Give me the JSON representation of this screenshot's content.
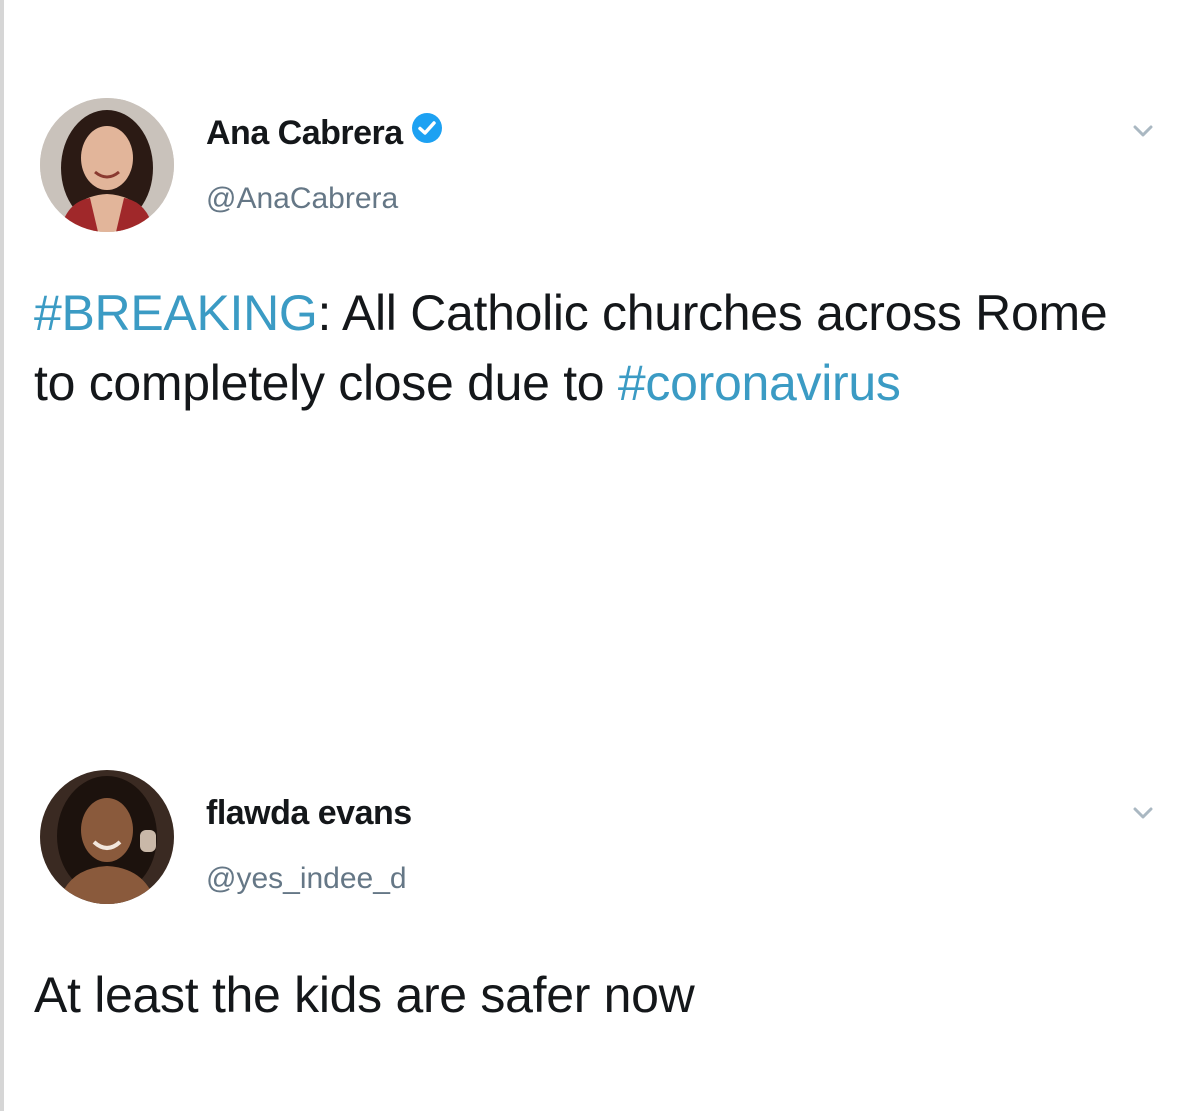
{
  "tweets": [
    {
      "display_name": "Ana Cabrera",
      "verified": true,
      "handle": "@AnaCabrera",
      "avatar_icon": "profile-photo",
      "menu_icon": "chevron-down-icon",
      "text_parts": {
        "hashtag_1": "#BREAKING",
        "body_1": ": All Catholic churches across Rome to completely close due to ",
        "hashtag_2": "#coronavirus"
      }
    },
    {
      "display_name": "flawda evans",
      "verified": false,
      "handle": "@yes_indee_d",
      "avatar_icon": "profile-photo",
      "menu_icon": "chevron-down-icon",
      "text": "At least the kids are safer now"
    }
  ],
  "colors": {
    "hashtag": "#3b9bc4",
    "verified_badge": "#1da1f2",
    "handle": "#657786",
    "text": "#14171a",
    "chevron": "#aab8c2"
  }
}
